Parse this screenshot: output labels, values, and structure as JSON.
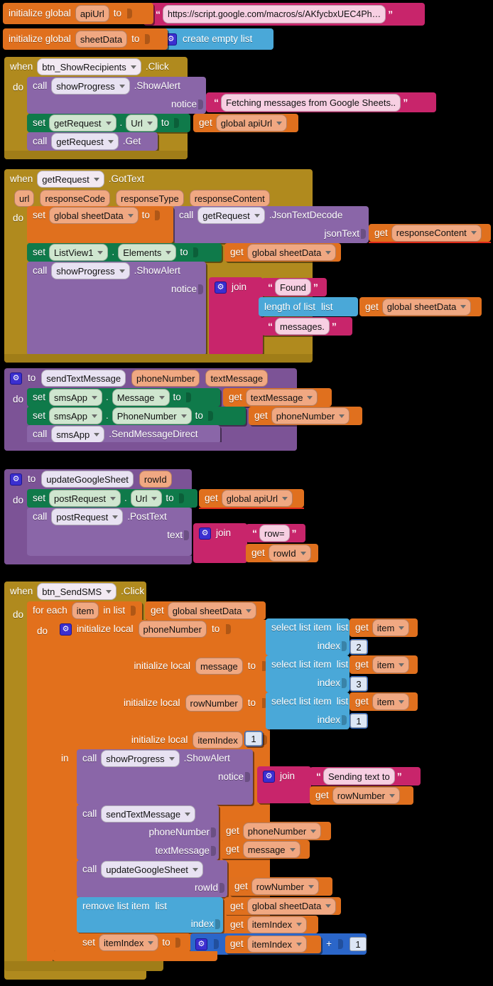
{
  "app": "MIT App Inventor Blocks Editor",
  "colors": {
    "variable_orange": "#e0701e",
    "text_magenta": "#c8256b",
    "list_blue": "#4aa8d8",
    "math_blue": "#2b66c9",
    "procedure_purple": "#8a66a8",
    "setter_green": "#0f7a4a",
    "event_gold": "#b08a1e"
  },
  "blocks": {
    "global_apiUrl": {
      "kw_init": "initialize global",
      "name": "apiUrl",
      "kw_to": "to",
      "value": "https://script.google.com/macros/s/AKfycbxUEC4Ph…"
    },
    "global_sheetData": {
      "kw_init": "initialize global",
      "name": "sheetData",
      "kw_to": "to",
      "value": "create empty list"
    },
    "event_showRecipients": {
      "kw_when": "when",
      "component": "btn_ShowRecipients",
      "event": ".Click",
      "kw_do": "do",
      "stmt1": {
        "kw_call": "call",
        "component": "showProgress",
        "method": ".ShowAlert",
        "arg_label": "notice",
        "arg_value": "Fetching messages from Google Sheets.."
      },
      "stmt2": {
        "kw_set": "set",
        "component": "getRequest",
        "dot": ".",
        "property": "Url",
        "kw_to": "to",
        "kw_get": "get",
        "var": "global apiUrl"
      },
      "stmt3": {
        "kw_call": "call",
        "component": "getRequest",
        "method": ".Get"
      }
    },
    "event_gotText": {
      "kw_when": "when",
      "component": "getRequest",
      "event": ".GotText",
      "params": [
        "url",
        "responseCode",
        "responseType",
        "responseContent"
      ],
      "kw_do": "do",
      "stmt1": {
        "kw_set": "set",
        "var": "global sheetData",
        "kw_to": "to",
        "kw_call": "call",
        "component": "getRequest",
        "method": ".JsonTextDecode",
        "arg_label": "jsonText",
        "kw_get": "get",
        "arg_var": "responseContent"
      },
      "stmt2": {
        "kw_set": "set",
        "component": "ListView1",
        "dot": ".",
        "property": "Elements",
        "kw_to": "to",
        "kw_get": "get",
        "var": "global sheetData"
      },
      "stmt3": {
        "kw_call": "call",
        "component": "showProgress",
        "method": ".ShowAlert",
        "arg_label": "notice",
        "join_label": "join",
        "piece1": "Found",
        "piece2_label": "length of list",
        "piece2_list_label": "list",
        "piece2_kw_get": "get",
        "piece2_var": "global sheetData",
        "piece3": "messages."
      }
    },
    "proc_sendTextMessage": {
      "kw_to": "to",
      "name": "sendTextMessage",
      "params": [
        "phoneNumber",
        "textMessage"
      ],
      "kw_do": "do",
      "stmt1": {
        "kw_set": "set",
        "component": "smsApp",
        "dot": ".",
        "property": "Message",
        "kw_to": "to",
        "kw_get": "get",
        "var": "textMessage"
      },
      "stmt2": {
        "kw_set": "set",
        "component": "smsApp",
        "dot": ".",
        "property": "PhoneNumber",
        "kw_to": "to",
        "kw_get": "get",
        "var": "phoneNumber"
      },
      "stmt3": {
        "kw_call": "call",
        "component": "smsApp",
        "method": ".SendMessageDirect"
      }
    },
    "proc_updateGoogleSheet": {
      "kw_to": "to",
      "name": "updateGoogleSheet",
      "params": [
        "rowId"
      ],
      "kw_do": "do",
      "stmt1": {
        "kw_set": "set",
        "component": "postRequest",
        "dot": ".",
        "property": "Url",
        "kw_to": "to",
        "kw_get": "get",
        "var": "global apiUrl"
      },
      "stmt2": {
        "kw_call": "call",
        "component": "postRequest",
        "method": ".PostText",
        "arg_label": "text",
        "join_label": "join",
        "piece1": "row=",
        "piece2_kw_get": "get",
        "piece2_var": "rowId"
      }
    },
    "event_sendSMS": {
      "kw_when": "when",
      "component": "btn_SendSMS",
      "event": ".Click",
      "kw_do": "do",
      "foreach": {
        "kw_for_each": "for each",
        "loop_var": "item",
        "kw_in_list": "in list",
        "kw_get": "get",
        "list_var": "global sheetData",
        "kw_do": "do"
      },
      "locals": [
        {
          "kw_init": "initialize local",
          "name": "phoneNumber",
          "kw_to": "to",
          "select_label": "select list item",
          "list_label": "list",
          "kw_get": "get",
          "list_var": "item",
          "index_label": "index",
          "index_value": "2"
        },
        {
          "kw_init": "initialize local",
          "name": "message",
          "kw_to": "to",
          "select_label": "select list item",
          "list_label": "list",
          "kw_get": "get",
          "list_var": "item",
          "index_label": "index",
          "index_value": "3"
        },
        {
          "kw_init": "initialize local",
          "name": "rowNumber",
          "kw_to": "to",
          "select_label": "select list item",
          "list_label": "list",
          "kw_get": "get",
          "list_var": "item",
          "index_label": "index",
          "index_value": "1"
        },
        {
          "kw_init": "initialize local",
          "name": "itemIndex",
          "kw_to": "to",
          "index_value": "1"
        }
      ],
      "kw_in": "in",
      "body": {
        "stmt1": {
          "kw_call": "call",
          "component": "showProgress",
          "method": ".ShowAlert",
          "arg_label": "notice",
          "join_label": "join",
          "piece1": "Sending text to",
          "piece2_kw_get": "get",
          "piece2_var": "rowNumber"
        },
        "stmt2": {
          "kw_call": "call",
          "proc": "sendTextMessage",
          "arg1_label": "phoneNumber",
          "arg1_kw_get": "get",
          "arg1_var": "phoneNumber",
          "arg2_label": "textMessage",
          "arg2_kw_get": "get",
          "arg2_var": "message"
        },
        "stmt3": {
          "kw_call": "call",
          "proc": "updateGoogleSheet",
          "arg1_label": "rowId",
          "arg1_kw_get": "get",
          "arg1_var": "rowNumber"
        },
        "stmt4": {
          "remove_label": "remove list item",
          "list_label": "list",
          "list_kw_get": "get",
          "list_var": "global sheetData",
          "index_label": "index",
          "index_kw_get": "get",
          "index_var": "itemIndex"
        },
        "stmt5": {
          "kw_set": "set",
          "var": "itemIndex",
          "kw_to": "to",
          "kw_get": "get",
          "operand_var": "itemIndex",
          "operator": "+",
          "operand_num": "1"
        }
      }
    }
  }
}
